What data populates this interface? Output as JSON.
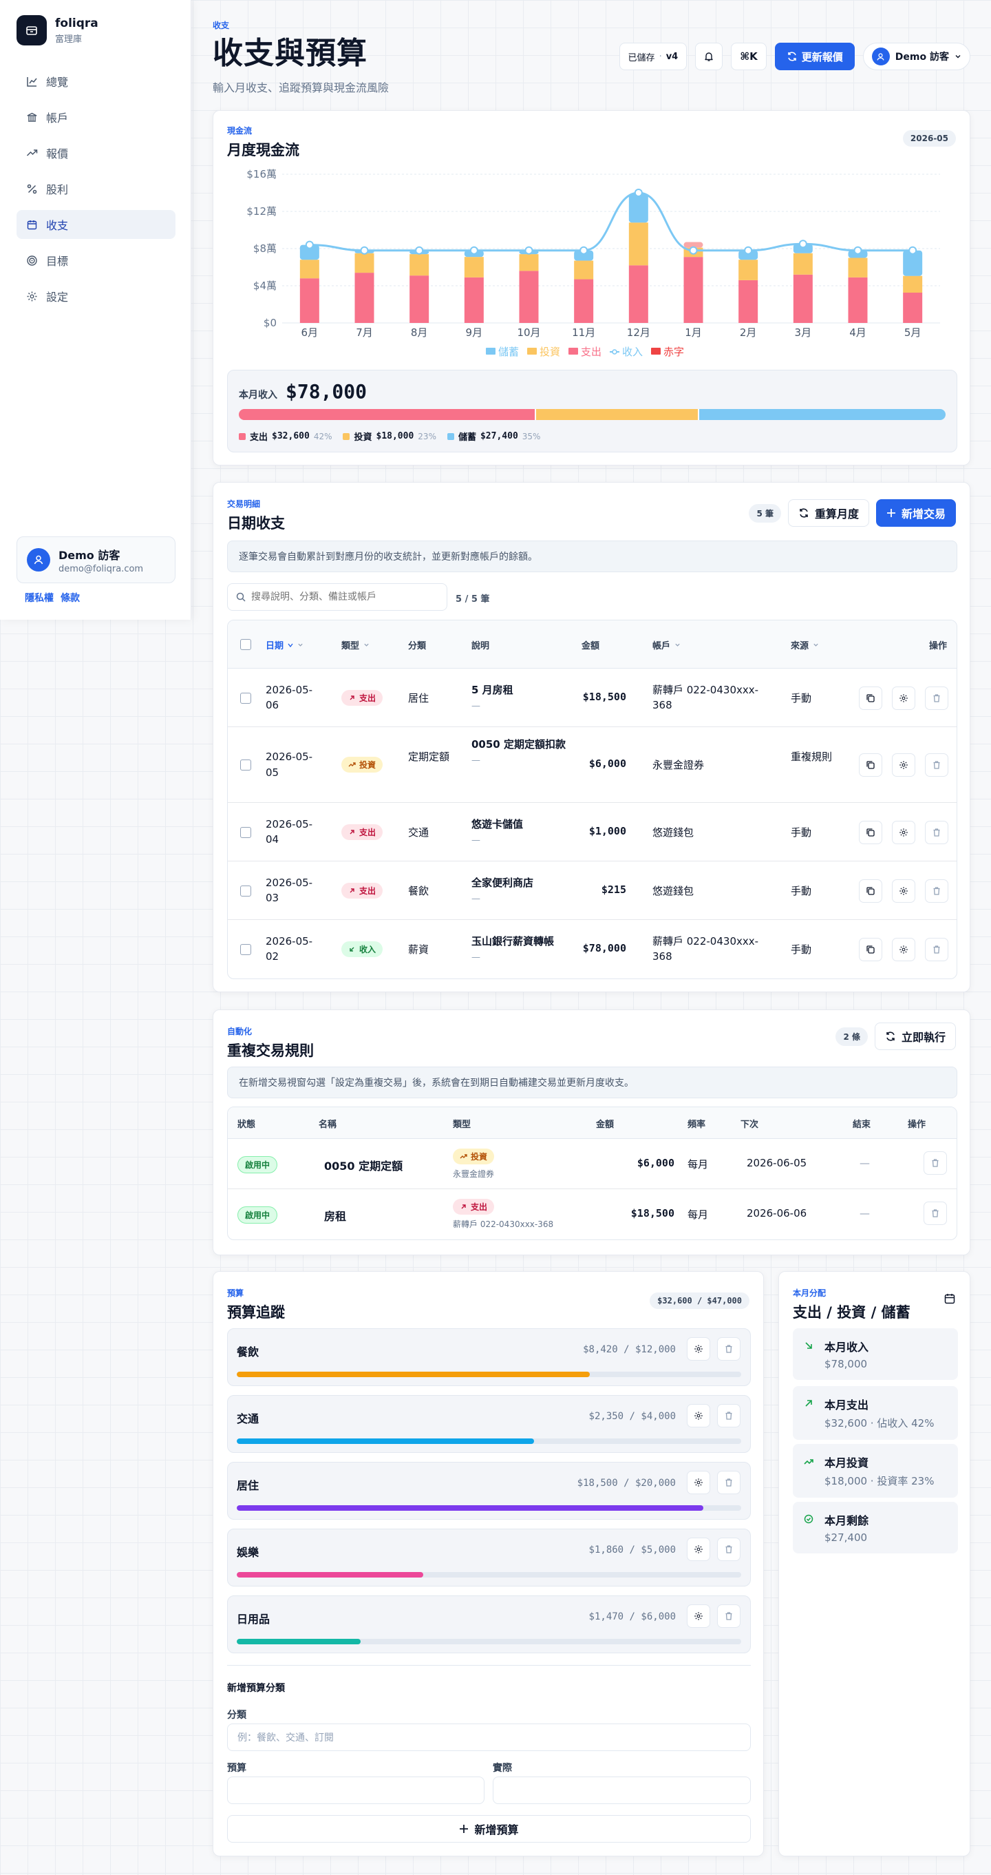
{
  "brand": {
    "name": "foliqra",
    "sub": "富理庫"
  },
  "nav": [
    {
      "label": "總覽",
      "icon": "chart-line-icon"
    },
    {
      "label": "帳戶",
      "icon": "bank-icon"
    },
    {
      "label": "報價",
      "icon": "trend-icon"
    },
    {
      "label": "股利",
      "icon": "percent-icon"
    },
    {
      "label": "收支",
      "icon": "calendar-icon",
      "active": true
    },
    {
      "label": "目標",
      "icon": "target-icon"
    },
    {
      "label": "設定",
      "icon": "gear-icon"
    }
  ],
  "user": {
    "name": "Demo 訪客",
    "email": "demo@foliqra.com",
    "short": "Demo 訪客"
  },
  "links": {
    "privacy": "隱私權",
    "terms": "條款"
  },
  "page": {
    "eyebrow": "收支",
    "title": "收支與預算",
    "subtitle": "輸入月收支、追蹤預算與現金流風險"
  },
  "topbar": {
    "saved": "已儲存",
    "dot": "·",
    "version": "v4",
    "shortcut": "⌘K",
    "refresh": "更新報價"
  },
  "cashflow": {
    "eyebrow": "現金流",
    "title": "月度現金流",
    "month_pill": "2026-05",
    "chart_data": {
      "type": "bar",
      "categories": [
        "6月",
        "7月",
        "8月",
        "9月",
        "10月",
        "11月",
        "12月",
        "1月",
        "2月",
        "3月",
        "4月",
        "5月"
      ],
      "series": [
        {
          "name": "支出",
          "values": [
            4.8,
            5.4,
            5.1,
            4.9,
            5.6,
            4.7,
            6.2,
            7.1,
            4.6,
            5.2,
            4.9,
            3.26
          ],
          "color": "#f87189"
        },
        {
          "name": "投資",
          "values": [
            2.0,
            2.1,
            2.3,
            2.2,
            1.8,
            2.0,
            4.6,
            1.0,
            2.2,
            2.3,
            2.1,
            1.8
          ],
          "color": "#fbc560"
        },
        {
          "name": "儲蓄",
          "values": [
            1.6,
            0.3,
            0.4,
            0.7,
            0.4,
            1.1,
            3.1,
            0,
            1.0,
            1.0,
            0.8,
            2.74
          ],
          "color": "#7cc8f4"
        },
        {
          "name": "赤字",
          "values": [
            0,
            0,
            0,
            0,
            0,
            0,
            0,
            0.6,
            0,
            0,
            0,
            0
          ],
          "color": "#ef4444"
        },
        {
          "name": "收入",
          "values": [
            8.4,
            7.8,
            7.8,
            7.8,
            7.8,
            7.8,
            14.0,
            7.8,
            7.8,
            8.5,
            7.8,
            7.8
          ],
          "color": "#7cc8f4"
        }
      ],
      "ylim": [
        0,
        16
      ],
      "yticks": [
        "$0",
        "$4萬",
        "$8萬",
        "$12萬",
        "$16萬"
      ],
      "legend": [
        "儲蓄",
        "投資",
        "支出",
        "收入",
        "赤字"
      ]
    },
    "summary": {
      "label": "本月收入",
      "value": "$78,000",
      "items": [
        {
          "name": "支出",
          "value": "$32,600",
          "pct": "42%",
          "share": 42,
          "color": "#f87189"
        },
        {
          "name": "投資",
          "value": "$18,000",
          "pct": "23%",
          "share": 23,
          "color": "#fbc560"
        },
        {
          "name": "儲蓄",
          "value": "$27,400",
          "pct": "35%",
          "share": 35,
          "color": "#7cc8f4"
        }
      ]
    }
  },
  "transactions": {
    "eyebrow": "交易明細",
    "title": "日期收支",
    "count": "5 筆",
    "recalc": "重算月度",
    "add": "新增交易",
    "note": "逐筆交易會自動累計到對應月份的收支統計，並更新對應帳戶的餘額。",
    "search_placeholder": "搜尋說明、分類、備註或帳戶",
    "result_count": "5 / 5 筆",
    "headers": {
      "date": "日期",
      "type": "類型",
      "category": "分類",
      "desc": "說明",
      "amount": "金額",
      "account": "帳戶",
      "source": "來源",
      "actions": "操作"
    },
    "rows": [
      {
        "date": "2026-05-06",
        "type": "支出",
        "cls": "exp",
        "category": "居住",
        "desc": "5 月房租",
        "sub": "—",
        "amount": "$18,500",
        "account": "薪轉戶 022-0430xxx-368",
        "source": "手動"
      },
      {
        "date": "2026-05-05",
        "type": "投資",
        "cls": "inv",
        "category": "定期定額",
        "desc": "0050 定期定額扣款",
        "sub": "—",
        "amount": "$6,000",
        "account": "永豐金證券",
        "source": "重複規則"
      },
      {
        "date": "2026-05-04",
        "type": "支出",
        "cls": "exp",
        "category": "交通",
        "desc": "悠遊卡儲值",
        "sub": "—",
        "amount": "$1,000",
        "account": "悠遊錢包",
        "source": "手動"
      },
      {
        "date": "2026-05-03",
        "type": "支出",
        "cls": "exp",
        "category": "餐飲",
        "desc": "全家便利商店",
        "sub": "—",
        "amount": "$215",
        "account": "悠遊錢包",
        "source": "手動"
      },
      {
        "date": "2026-05-02",
        "type": "收入",
        "cls": "inc",
        "category": "薪資",
        "desc": "玉山銀行薪資轉帳",
        "sub": "—",
        "amount": "$78,000",
        "account": "薪轉戶 022-0430xxx-368",
        "source": "手動"
      }
    ]
  },
  "rules": {
    "eyebrow": "自動化",
    "title": "重複交易規則",
    "count": "2 條",
    "run": "立即執行",
    "note": "在新增交易視窗勾選「設定為重複交易」後，系統會在到期日自動補建交易並更新月度收支。",
    "headers": {
      "status": "狀態",
      "name": "名稱",
      "type": "類型",
      "amount": "金額",
      "freq": "頻率",
      "next": "下次",
      "end": "結束",
      "actions": "操作"
    },
    "rows": [
      {
        "status": "啟用中",
        "name": "0050 定期定額",
        "type": "投資",
        "cls": "inv",
        "account": "永豐金證券",
        "amount": "$6,000",
        "freq": "每月",
        "next": "2026-06-05",
        "end": "—"
      },
      {
        "status": "啟用中",
        "name": "房租",
        "type": "支出",
        "cls": "exp",
        "account": "薪轉戶 022-0430xxx-368",
        "amount": "$18,500",
        "freq": "每月",
        "next": "2026-06-06",
        "end": "—"
      }
    ]
  },
  "budget": {
    "eyebrow": "預算",
    "title": "預算追蹤",
    "total": "$32,600 / $47,000",
    "items": [
      {
        "name": "餐飲",
        "spent": "$8,420",
        "limit": "$12,000",
        "ratio": 0.7,
        "color": "#f59e0b"
      },
      {
        "name": "交通",
        "spent": "$2,350",
        "limit": "$4,000",
        "ratio": 0.59,
        "color": "#0ea5e9"
      },
      {
        "name": "居住",
        "spent": "$18,500",
        "limit": "$20,000",
        "ratio": 0.925,
        "color": "#7c3aed"
      },
      {
        "name": "娛樂",
        "spent": "$1,860",
        "limit": "$5,000",
        "ratio": 0.37,
        "color": "#ec4899"
      },
      {
        "name": "日用品",
        "spent": "$1,470",
        "limit": "$6,000",
        "ratio": 0.245,
        "color": "#14b8a6"
      }
    ],
    "sep": "/",
    "form": {
      "title": "新增預算分類",
      "category_label": "分類",
      "category_placeholder": "例：餐飲、交通、訂閱",
      "budget_label": "預算",
      "actual_label": "實際",
      "submit": "新增預算"
    }
  },
  "allocation": {
    "eyebrow": "本月分配",
    "title": "支出 / 投資 / 儲蓄",
    "items": [
      {
        "title": "本月收入",
        "value": "$78,000",
        "icon": "arrow-down-right-icon",
        "color": "#16a34a"
      },
      {
        "title": "本月支出",
        "value": "$32,600 · 佔收入 42%",
        "icon": "arrow-up-right-icon",
        "color": "#16a34a"
      },
      {
        "title": "本月投資",
        "value": "$18,000 · 投資率 23%",
        "icon": "trend-up-icon",
        "color": "#16a34a"
      },
      {
        "title": "本月剩餘",
        "value": "$27,400",
        "icon": "check-circle-icon",
        "color": "#16a34a"
      }
    ]
  }
}
